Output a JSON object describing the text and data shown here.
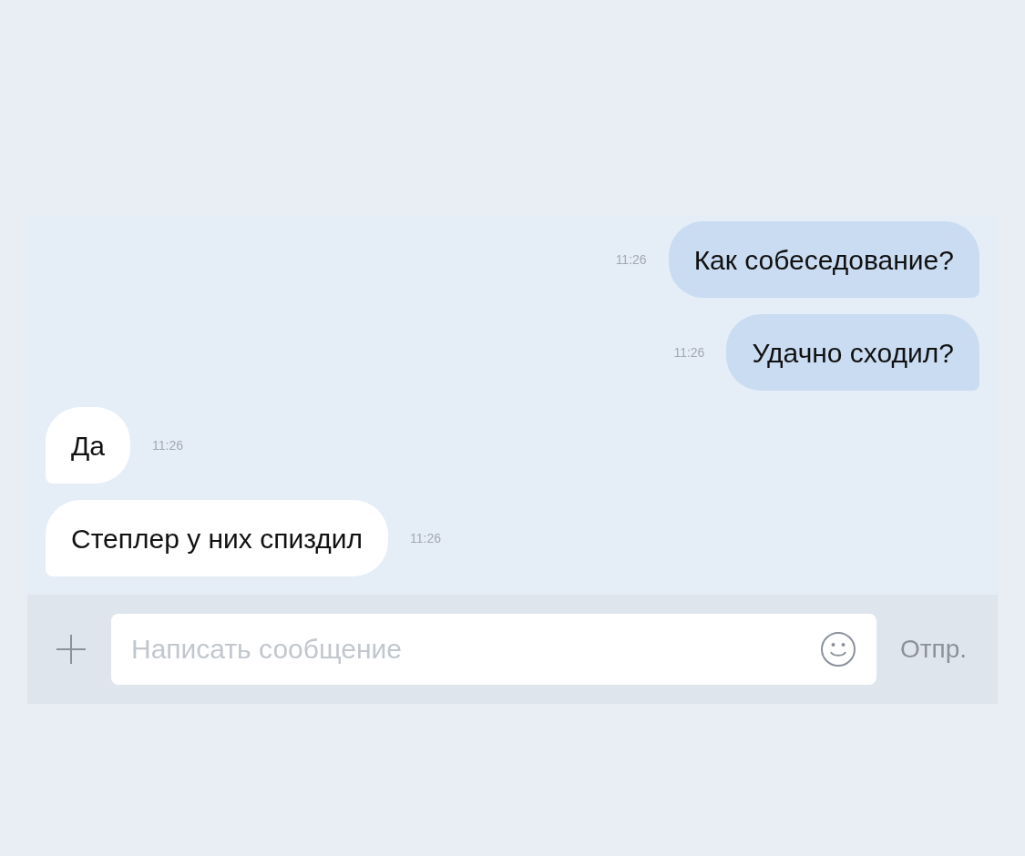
{
  "messages": [
    {
      "kind": "outgoing",
      "text": "Как собеседование?",
      "time": "11:26"
    },
    {
      "kind": "outgoing",
      "text": "Удачно сходил?",
      "time": "11:26"
    },
    {
      "kind": "incoming",
      "text": "Да",
      "time": "11:26"
    },
    {
      "kind": "incoming",
      "text": "Степлер у них спиздил",
      "time": "11:26"
    }
  ],
  "composer": {
    "placeholder": "Написать сообщение",
    "send": "Отпр."
  }
}
